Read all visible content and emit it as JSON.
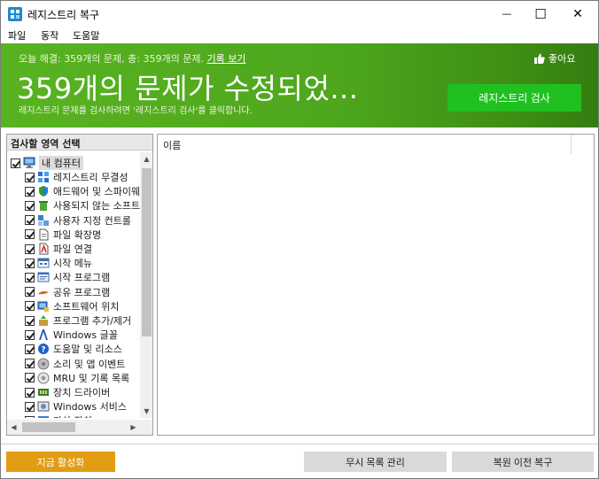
{
  "window": {
    "title": "레지스트리 복구",
    "minimize_glyph": "—",
    "maximize_glyph": "☐",
    "close_glyph": "✕"
  },
  "menu": {
    "items": [
      "파일",
      "동작",
      "도움말"
    ]
  },
  "banner": {
    "today_prefix": "오늘 해결:",
    "today_count": "359개의 문제,",
    "total_prefix": "총:",
    "total_count": "359개의 문제.",
    "history_link": "기록 보기",
    "like_label": "좋아요",
    "headline": "359개의 문제가 수정되었...",
    "hint": "레지스트리 문제를 검사하려면 '레지스트리 검사'를 클릭합니다.",
    "scan_button": "레지스트리 검사",
    "scan_color": "#20c020"
  },
  "left_panel": {
    "header": "검사할 영역 선택",
    "root": "내 컴퓨터",
    "items": [
      {
        "label": "레지스트리 무결성",
        "icon": "registry-blocks-icon"
      },
      {
        "label": "애드웨어 및 스파이웨",
        "icon": "shield-icon"
      },
      {
        "label": "사용되지 않는 소프트",
        "icon": "recycle-bin-icon"
      },
      {
        "label": "사용자 지정 컨트롤",
        "icon": "controls-icon"
      },
      {
        "label": "파일 확장명",
        "icon": "file-extension-icon"
      },
      {
        "label": "파일 연결",
        "icon": "file-association-icon"
      },
      {
        "label": "시작 메뉴",
        "icon": "start-menu-icon"
      },
      {
        "label": "시작 프로그램",
        "icon": "startup-programs-icon"
      },
      {
        "label": "공유 프로그램",
        "icon": "shared-programs-icon"
      },
      {
        "label": "소프트웨어 위치",
        "icon": "software-location-icon"
      },
      {
        "label": "프로그램 추가/제거",
        "icon": "add-remove-programs-icon"
      },
      {
        "label": "Windows 글꼴",
        "icon": "fonts-icon"
      },
      {
        "label": "도움말 및 리소스",
        "icon": "help-icon"
      },
      {
        "label": "소리 및 앱 이벤트",
        "icon": "sound-events-icon"
      },
      {
        "label": "MRU 및 기록 목록",
        "icon": "mru-history-icon"
      },
      {
        "label": "장치 드라이버",
        "icon": "device-driver-icon"
      },
      {
        "label": "Windows 서비스",
        "icon": "windows-services-icon"
      },
      {
        "label": "가상 장치",
        "icon": "virtual-device-icon"
      }
    ]
  },
  "right_panel": {
    "column_name": "이름"
  },
  "footer": {
    "activate_button": "지금 활성화",
    "ignore_button": "무시 목록 관리",
    "restore_button": "복원 이전 복구",
    "activate_color": "#e39d14"
  }
}
